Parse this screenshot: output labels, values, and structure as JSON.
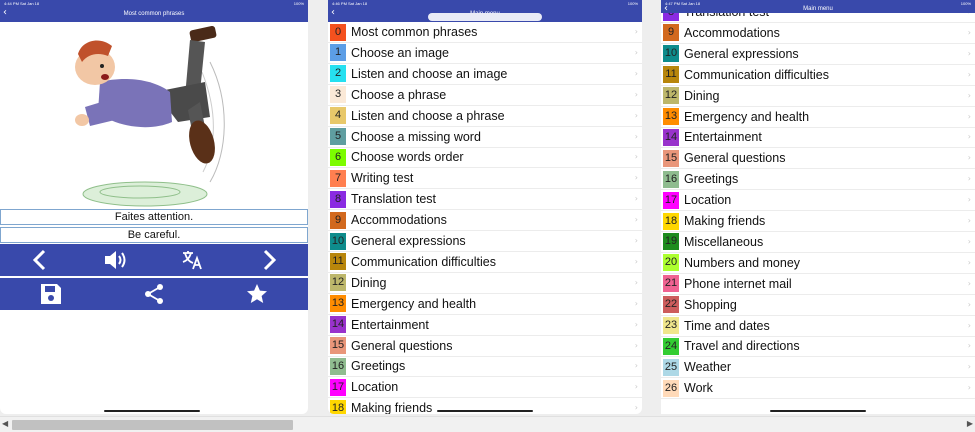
{
  "screen1": {
    "status_time": "4:44 PM  Sat Jan 18",
    "status_batt": "100%",
    "title": "Most common phrases",
    "phrase_fr": "Faites attention.",
    "phrase_en": "Be careful."
  },
  "screen2": {
    "status_time": "4:46 PM  Sat Jan 18",
    "status_batt": "100%",
    "title": "Main menu",
    "items": [
      {
        "num": "0",
        "label": "Most common phrases",
        "color": "#f4511e"
      },
      {
        "num": "1",
        "label": "Choose an image",
        "color": "#5c9ee6"
      },
      {
        "num": "2",
        "label": "Listen and choose an image",
        "color": "#26e0f0"
      },
      {
        "num": "3",
        "label": "Choose a phrase",
        "color": "#fbe9d7"
      },
      {
        "num": "4",
        "label": "Listen and choose a phrase",
        "color": "#e8c86a"
      },
      {
        "num": "5",
        "label": "Choose a missing word",
        "color": "#5f9ea0"
      },
      {
        "num": "6",
        "label": "Choose words order",
        "color": "#7cfc00"
      },
      {
        "num": "7",
        "label": "Writing test",
        "color": "#ff7f50"
      },
      {
        "num": "8",
        "label": "Translation test",
        "color": "#8a2be2"
      },
      {
        "num": "9",
        "label": "Accommodations",
        "color": "#d2691e"
      },
      {
        "num": "10",
        "label": "General expressions",
        "color": "#0e8c8c"
      },
      {
        "num": "11",
        "label": "Communication difficulties",
        "color": "#b8860b"
      },
      {
        "num": "12",
        "label": "Dining",
        "color": "#bdb76b"
      },
      {
        "num": "13",
        "label": "Emergency and health",
        "color": "#ff8c00"
      },
      {
        "num": "14",
        "label": "Entertainment",
        "color": "#9932cc"
      },
      {
        "num": "15",
        "label": "General questions",
        "color": "#e9967a"
      },
      {
        "num": "16",
        "label": "Greetings",
        "color": "#8fbc8f"
      },
      {
        "num": "17",
        "label": "Location",
        "color": "#ff00ff"
      },
      {
        "num": "18",
        "label": "Making friends",
        "color": "#ffd700"
      }
    ]
  },
  "screen3": {
    "status_time": "4:47 PM  Sat Jan 18",
    "status_batt": "100%",
    "title": "Main menu",
    "items": [
      {
        "num": "8",
        "label": "Translation test",
        "color": "#8a2be2"
      },
      {
        "num": "9",
        "label": "Accommodations",
        "color": "#d2691e"
      },
      {
        "num": "10",
        "label": "General expressions",
        "color": "#0e8c8c"
      },
      {
        "num": "11",
        "label": "Communication difficulties",
        "color": "#b8860b"
      },
      {
        "num": "12",
        "label": "Dining",
        "color": "#bdb76b"
      },
      {
        "num": "13",
        "label": "Emergency and health",
        "color": "#ff8c00"
      },
      {
        "num": "14",
        "label": "Entertainment",
        "color": "#9932cc"
      },
      {
        "num": "15",
        "label": "General questions",
        "color": "#e9967a"
      },
      {
        "num": "16",
        "label": "Greetings",
        "color": "#8fbc8f"
      },
      {
        "num": "17",
        "label": "Location",
        "color": "#ff00ff"
      },
      {
        "num": "18",
        "label": "Making friends",
        "color": "#ffd700"
      },
      {
        "num": "19",
        "label": "Miscellaneous",
        "color": "#1e8c1e"
      },
      {
        "num": "20",
        "label": "Numbers and money",
        "color": "#adff2f"
      },
      {
        "num": "21",
        "label": "Phone internet mail",
        "color": "#f06292"
      },
      {
        "num": "22",
        "label": "Shopping",
        "color": "#cd5c5c"
      },
      {
        "num": "23",
        "label": "Time and dates",
        "color": "#f0e68c"
      },
      {
        "num": "24",
        "label": "Travel and directions",
        "color": "#32cd32"
      },
      {
        "num": "25",
        "label": "Weather",
        "color": "#add8e6"
      },
      {
        "num": "26",
        "label": "Work",
        "color": "#ffdab9"
      }
    ]
  },
  "colors": {
    "header": "#3949ab",
    "phrase_border": "#7fa6cf"
  },
  "icons": [
    "back-icon",
    "previous-icon",
    "speaker-icon",
    "translate-icon",
    "next-icon",
    "save-icon",
    "share-icon",
    "star-icon",
    "chevron-right-icon"
  ]
}
